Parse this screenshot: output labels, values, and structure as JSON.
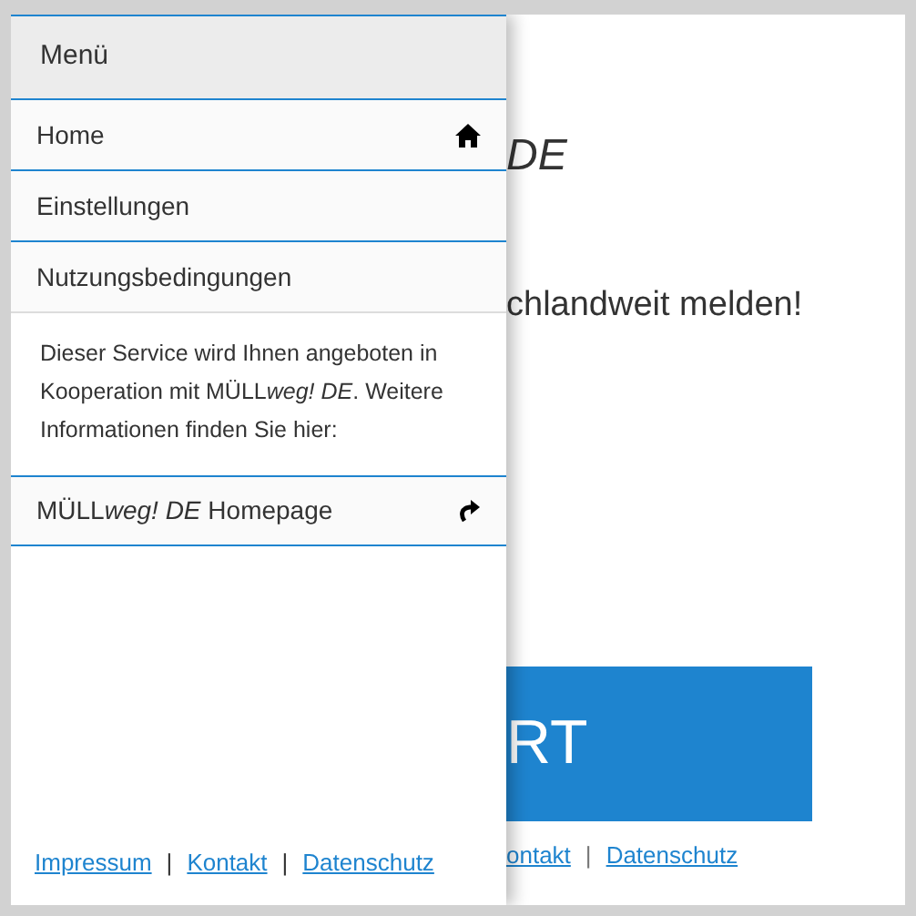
{
  "background_page": {
    "title_fragment": "DE",
    "tagline_fragment": "chlandweit melden!",
    "button_fragment": "RT",
    "footer_links": [
      "ontakt",
      "Datenschutz"
    ],
    "separator": "|"
  },
  "menu": {
    "title": "Menü",
    "items": [
      {
        "label": "Home"
      },
      {
        "label": "Einstellungen"
      },
      {
        "label": "Nutzungsbedingungen"
      }
    ],
    "info_text": [
      {
        "text": "Dieser Service wird Ihnen angeboten in Kooperation mit MÜLL",
        "italic": false
      },
      {
        "text": "weg! DE",
        "italic": true
      },
      {
        "text": ". Weitere Informationen finden Sie hier:",
        "italic": false
      }
    ],
    "external_link": [
      {
        "text": "MÜLL",
        "italic": false
      },
      {
        "text": "weg! DE",
        "italic": true
      },
      {
        "text": " Homepage",
        "italic": false
      }
    ],
    "footer_links": [
      "Impressum",
      "Kontakt",
      "Datenschutz"
    ],
    "separator": "|"
  }
}
